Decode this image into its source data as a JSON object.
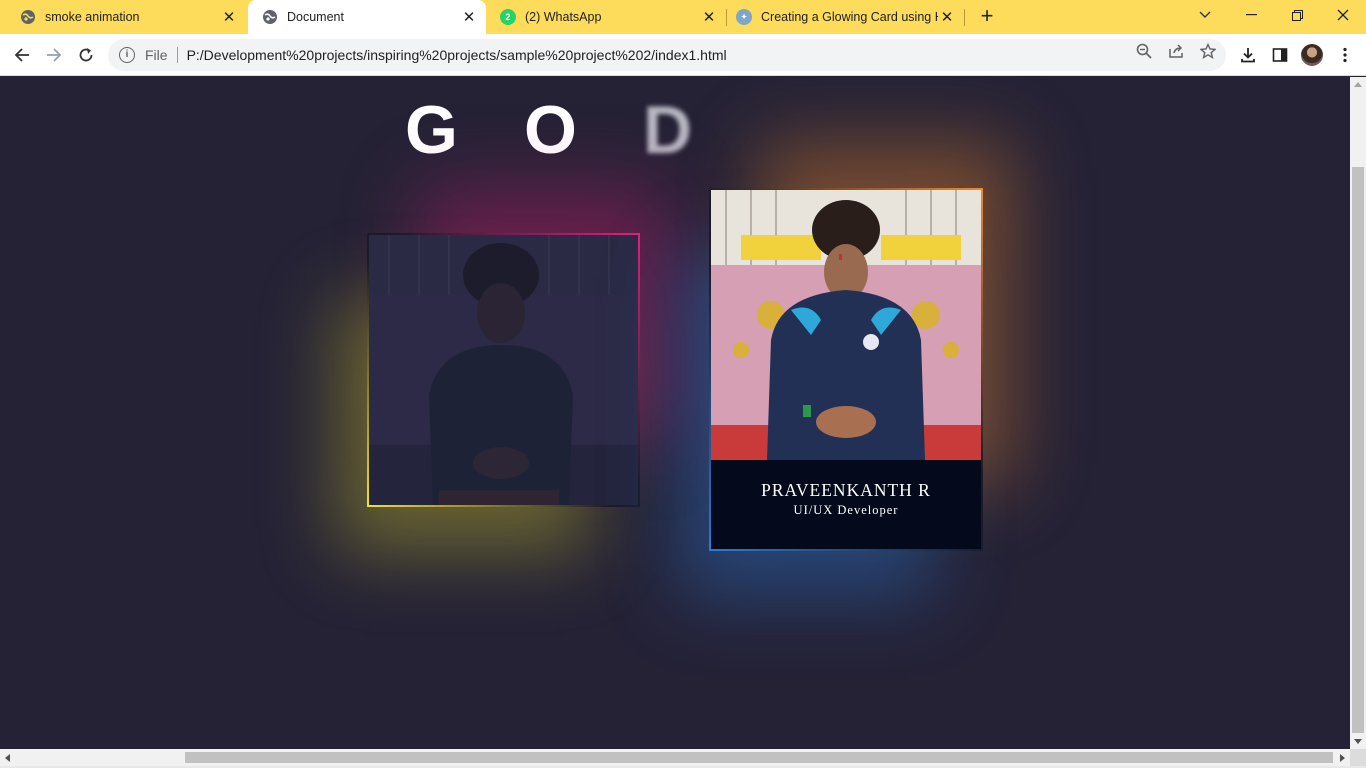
{
  "browser": {
    "tabs": [
      {
        "title": "smoke animation",
        "icon": "globe-icon",
        "active": false
      },
      {
        "title": "Document",
        "icon": "globe-icon",
        "active": true
      },
      {
        "title": "(2) WhatsApp",
        "icon": "whatsapp-icon",
        "badge": "2",
        "active": false
      },
      {
        "title": "Creating a Glowing Card using H",
        "icon": "site-icon",
        "active": false
      }
    ],
    "new_tab": "+",
    "window_controls": {
      "dropdown": "⌄",
      "minimize": "—",
      "restore": "❐",
      "close": "✕"
    },
    "toolbar": {
      "back": "←",
      "forward": "→",
      "reload": "↻",
      "scheme_label": "File",
      "url": "P:/Development%20projects/inspiring%20projects/sample%20project%202/index1.html"
    }
  },
  "page": {
    "heading_letters": [
      "G",
      "O",
      "D"
    ],
    "cards": [
      {
        "name": "",
        "role": "",
        "border_colors": [
          "#f3e12a",
          "#e81e79"
        ],
        "photo": "portrait-dimmed"
      },
      {
        "name": "PRAVEENKANTH R",
        "role": "UI/UX Developer",
        "border_colors": [
          "#2a7bd6",
          "#f08a2a"
        ],
        "photo": "portrait"
      }
    ]
  },
  "colors": {
    "tabstrip": "#fddc5c",
    "page_background": "#252236",
    "caption_background": "#040a1c"
  }
}
